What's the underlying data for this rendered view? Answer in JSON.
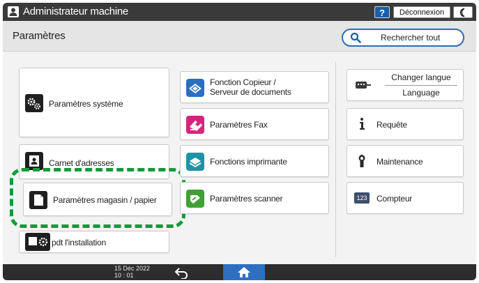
{
  "topbar": {
    "user_icon": "user-icon",
    "title": "Administrateur machine",
    "help_label": "?",
    "logout_label": "Déconnexion",
    "moon_icon": "moon-icon"
  },
  "header": {
    "title": "Paramètres",
    "search_label": "Rechercher tout",
    "search_icon": "search-icon"
  },
  "tiles": {
    "system": {
      "label": "Paramètres système",
      "icon": "gears-icon"
    },
    "carnet": {
      "label": "Carnet d'adresses",
      "icon": "address-book-icon"
    },
    "magasin": {
      "label": "Paramètres magasin / papier",
      "icon": "paper-tray-icon"
    },
    "pdt": {
      "label": "pdt l'installation",
      "icon": "installation-icon"
    },
    "copier": {
      "label_line1": "Fonction Copieur /",
      "label_line2": "Serveur de documents",
      "icon": "copier-icon"
    },
    "fax": {
      "label": "Paramètres Fax",
      "icon": "fax-icon"
    },
    "printer": {
      "label": "Fonctions imprimante",
      "icon": "printer-icon"
    },
    "scanner": {
      "label": "Paramètres scanner",
      "icon": "scanner-icon"
    },
    "language": {
      "label_line1": "Changer langue",
      "label_line2": "Language",
      "icon": "keyboard-icon"
    },
    "request": {
      "label": "Requête",
      "icon": "info-icon"
    },
    "maintenance": {
      "label": "Maintenance",
      "icon": "wrench-icon"
    },
    "counter": {
      "label": "Compteur",
      "icon": "counter-icon",
      "icon_text": "123"
    }
  },
  "highlight_color": "#149a3a",
  "bottombar": {
    "date": "15 Déc 2022",
    "time": "10 : 01",
    "back_icon": "back-arrow-icon",
    "home_icon": "home-icon",
    "home_color": "#2f6fc0"
  }
}
